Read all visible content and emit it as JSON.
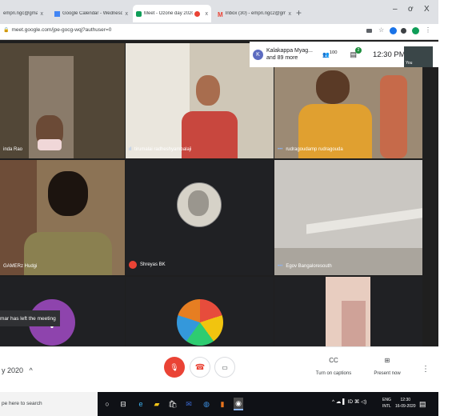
{
  "browser": {
    "tabs": [
      {
        "title": "empri.ngc@gmail.co",
        "fav_color": "#c5221f"
      },
      {
        "title": "Google Calendar - Wednesday, 1",
        "fav_color": "#4285f4"
      },
      {
        "title": "Meet - Ozone day 2020",
        "fav_color": "#0f9d58"
      },
      {
        "title": "",
        "fav_color": "#ea4335"
      },
      {
        "title": "Inbox (30) - empri.ngc2@gmail.c",
        "fav_color": "#ea4335"
      }
    ],
    "close_glyph": "x",
    "newtab_glyph": "+",
    "win_min": "–",
    "win_max": "ơ",
    "win_close": "X",
    "url": "meet.google.com/jpe-gocg-wqj?authuser=0",
    "extension_colors": [
      "#5f6368",
      "#9aa0a6",
      "#1a73e8",
      "#3c4043",
      "#0f9d58",
      "#5f6368"
    ]
  },
  "meet": {
    "title": "y 2020",
    "top_participant": "Kalakappa Myag... and 89 more",
    "participant_count": "100",
    "chat_badge": "2",
    "time": "12:30 PM",
    "self_label": "You",
    "left_notice": "mar has left the meeting",
    "tiles": [
      {
        "name": "inda Rao",
        "bg": "#6a5a48",
        "accent": "#b89a7a",
        "mic": "none"
      },
      {
        "name": "tirumalai radheshyambalaji",
        "bg": "#d8d2c4",
        "accent": "#c8473e",
        "mic": "active"
      },
      {
        "name": "rudragoudamp rudragouda",
        "bg": "#a9967a",
        "accent": "#e0a030",
        "mic": "active"
      },
      {
        "name": "GAMERz Hudgi",
        "bg": "#7a6a50",
        "accent": "#3a3a2a",
        "mic": "none"
      },
      {
        "name": "Shreyas BK",
        "bg": "#202124",
        "accent": "#d0d0d0",
        "mic": "off"
      },
      {
        "name": "Egov Bangaloresouth",
        "bg": "#c9c6c1",
        "accent": "#a09a92",
        "mic": "active"
      },
      {
        "name": "",
        "bg": "#202124",
        "accent": "#8e44ad",
        "mic": "none"
      },
      {
        "name": "",
        "bg": "#202124",
        "accent": "#e67e22",
        "mic": "none"
      },
      {
        "name": "",
        "bg": "#e8cdc0",
        "accent": "#d6a39a",
        "mic": "none"
      }
    ],
    "avatar_letter": "V",
    "captions_label": "Turn on captions",
    "present_label": "Present now",
    "more_glyph": "⋮",
    "chevron": "^"
  },
  "taskbar": {
    "search_placeholder": "pe here to search",
    "lang_top": "ENG",
    "lang_bottom": "INTL",
    "time": "12:30",
    "date": "16-09-2020",
    "tray": "^ ☁ ▌ ID ⌘ ◁)"
  }
}
